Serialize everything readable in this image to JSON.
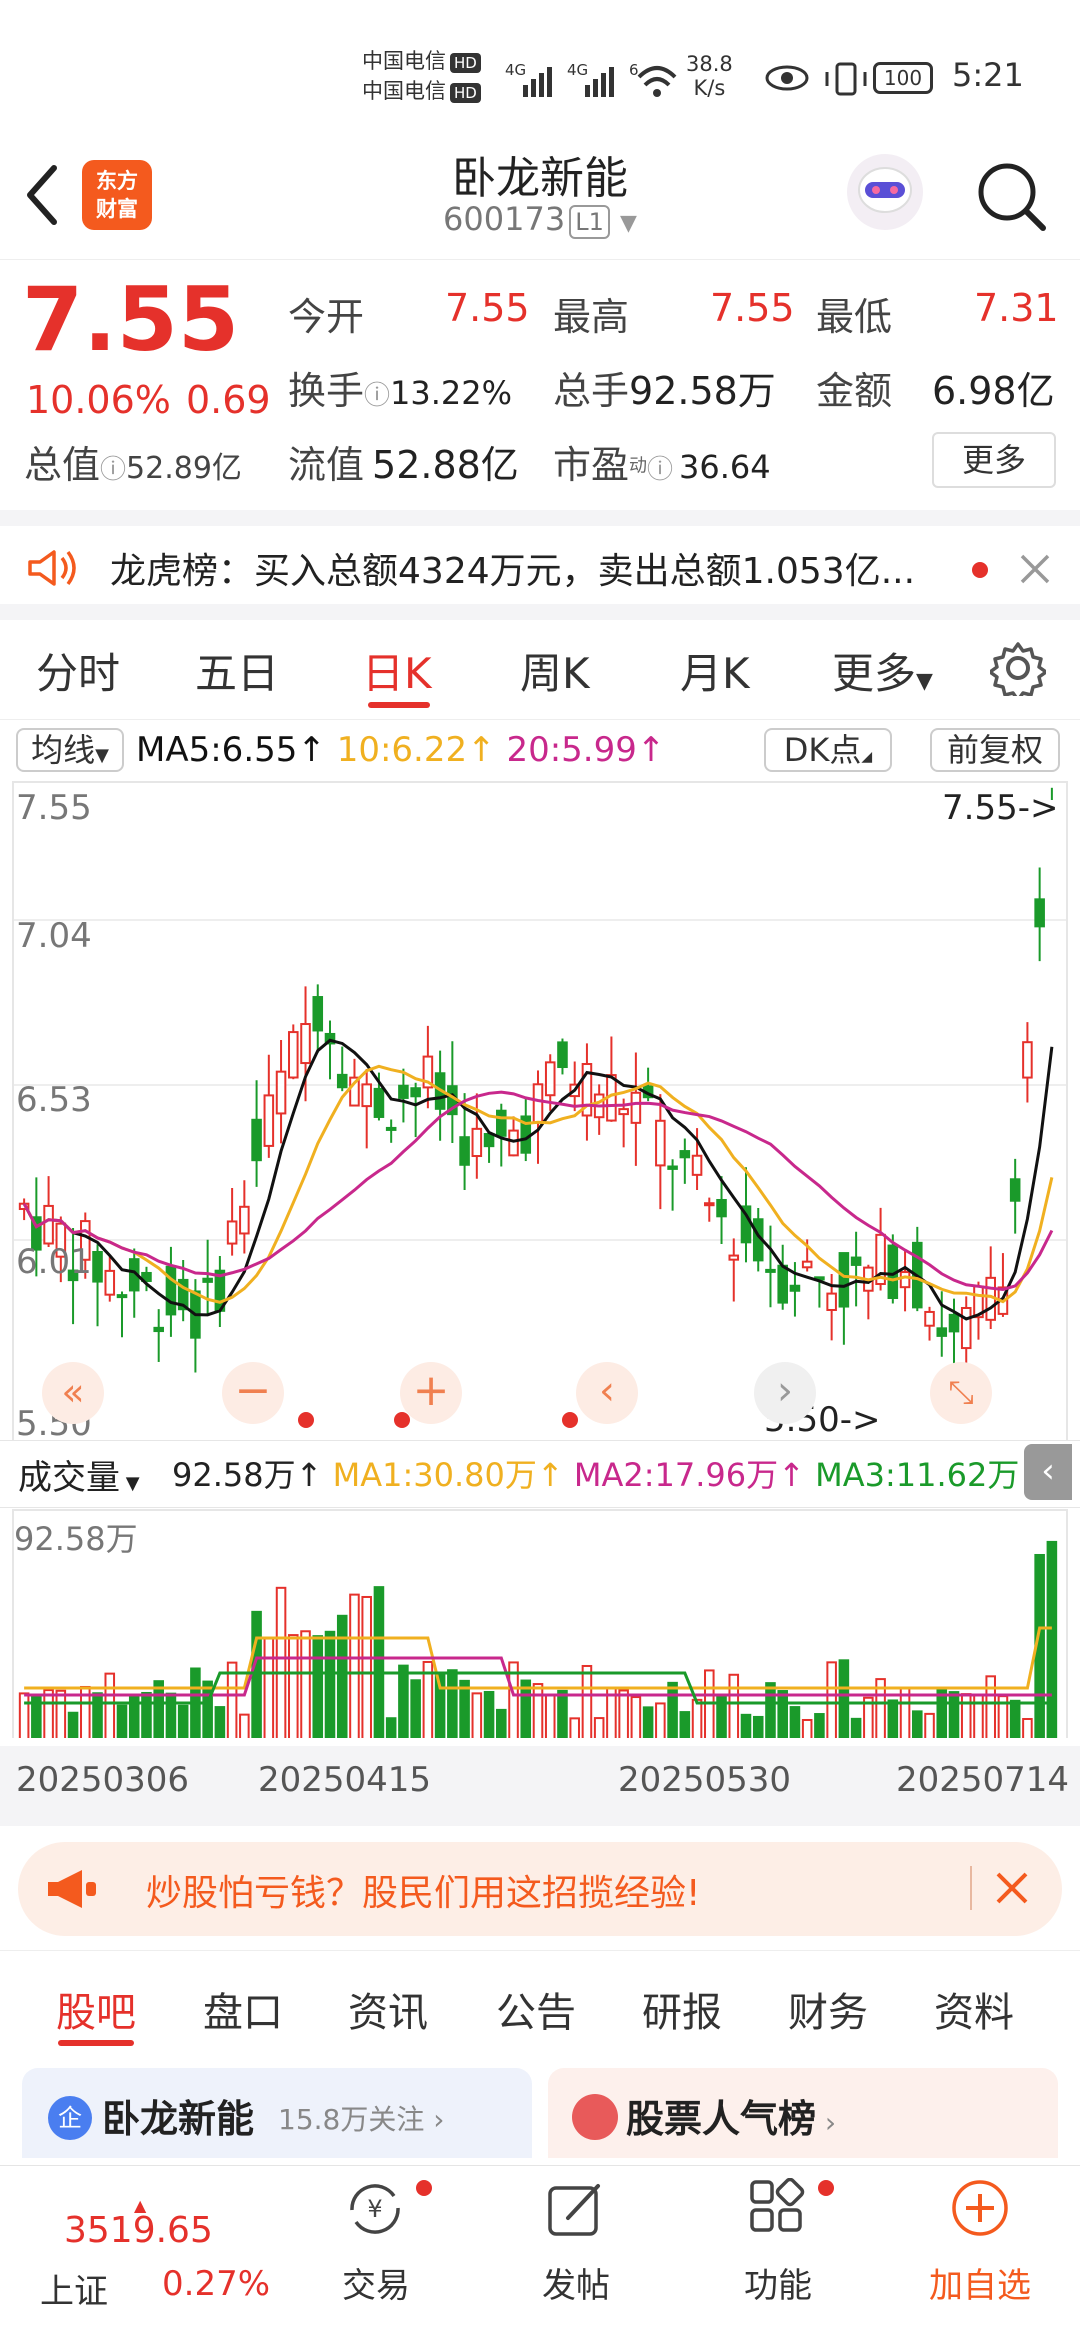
{
  "status_bar": {
    "carrier1": "中国电信",
    "carrier2": "中国电信",
    "hd": "HD",
    "net1": "4G",
    "net2": "4G",
    "net3": "6",
    "speed_value": "38.8",
    "speed_unit": "K/s",
    "battery": "100",
    "time": "5:21"
  },
  "header": {
    "logo_line1": "东方",
    "logo_line2": "财富",
    "stock_name": "卧龙新能",
    "stock_code": "600173",
    "level": "L1"
  },
  "quote": {
    "price": "7.55",
    "change_pct": "10.06%",
    "change_amt": "0.69",
    "total_value_label": "总值",
    "total_value": "52.89亿",
    "open_label": "今开",
    "open": "7.55",
    "high_label": "最高",
    "high": "7.55",
    "low_label": "最低",
    "low": "7.31",
    "turnover_label": "换手",
    "turnover": "13.22%",
    "volume_label": "总手",
    "volume": "92.58万",
    "amount_label": "金额",
    "amount": "6.98亿",
    "float_label": "流值",
    "float_value": "52.88亿",
    "pe_label": "市盈",
    "pe_sup": "动",
    "pe": "36.64",
    "more": "更多"
  },
  "notice": {
    "label": "龙虎榜：",
    "text": "买入总额4324万元，卖出总额1.053亿..."
  },
  "chart_tabs": [
    "分时",
    "五日",
    "日K",
    "周K",
    "月K",
    "更多"
  ],
  "active_chart_tab": "日K",
  "ma_legend": {
    "selector": "均线",
    "ma5": "MA5:6.55",
    "ma10": "10:6.22",
    "ma20": "20:5.99",
    "dk": "DK点",
    "adjust": "前复权"
  },
  "price_axis": [
    "7.55",
    "7.04",
    "6.53",
    "6.01",
    "5.50"
  ],
  "price_max_marker": "7.55->",
  "price_min_marker": "5.50->",
  "volume_legend": {
    "selector": "成交量",
    "vol": "92.58万",
    "ma1": "MA1:30.80万",
    "ma2": "MA2:17.96万",
    "ma3": "MA3:11.62万",
    "max": "92.58万"
  },
  "dates": [
    "20250306",
    "20250415",
    "20250530",
    "20250714"
  ],
  "colors": {
    "up": "#e5312b",
    "down": "#1a9a2a",
    "ma5": "#111111",
    "ma10": "#f0b020",
    "ma20": "#c8288c",
    "accent": "#f45a1e"
  },
  "ad": {
    "text": "炒股怕亏钱？股民们用这招揽经验!"
  },
  "bottom_tabs": [
    "股吧",
    "盘口",
    "资讯",
    "公告",
    "研报",
    "财务",
    "资料"
  ],
  "active_bottom_tab": "股吧",
  "cards": {
    "left_badge": "企",
    "left_title": "卧龙新能",
    "left_follow": "15.8万关注",
    "right_title": "股票人气榜"
  },
  "bottom_nav": {
    "index_value": "3519.65",
    "index_name": "上证",
    "index_pct": "0.27%",
    "trade": "交易",
    "post": "发帖",
    "func": "功能",
    "add": "加自选"
  }
}
